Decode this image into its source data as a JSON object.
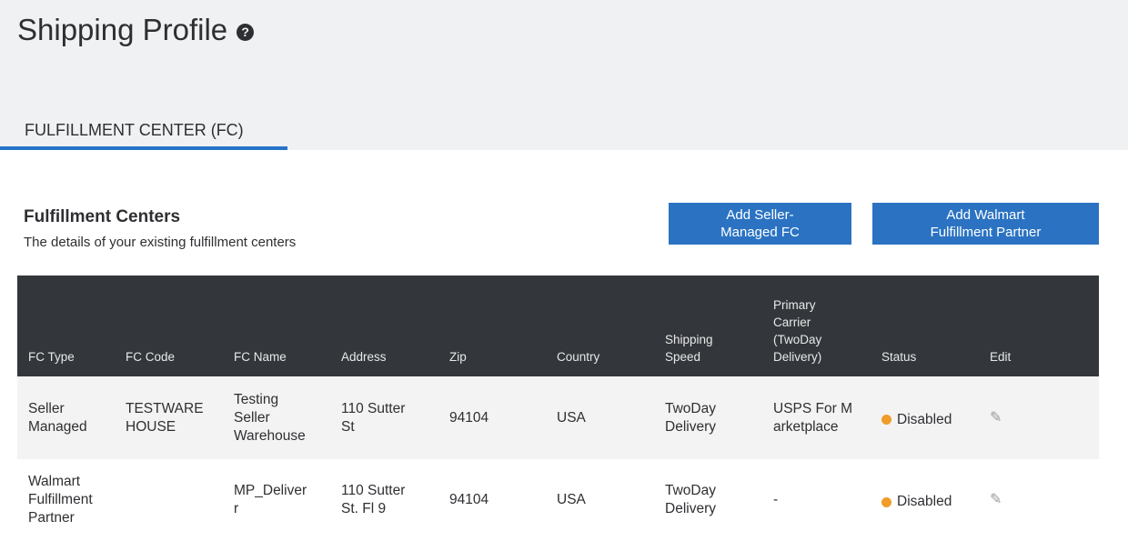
{
  "header": {
    "title": "Shipping Profile",
    "help_icon": "question-circle-icon"
  },
  "tabs": [
    {
      "label": "FULFILLMENT CENTER (FC)",
      "active": true
    }
  ],
  "section": {
    "title": "Fulfillment Centers",
    "subtitle": "The details of your existing fulfillment centers"
  },
  "buttons": {
    "add_seller": {
      "line1": "Add Seller-",
      "line2": "Managed FC"
    },
    "add_walmart": {
      "line1": "Add Walmart",
      "line2": "Fulfillment Partner"
    }
  },
  "table": {
    "columns": [
      "FC Type",
      "FC Code",
      "FC Name",
      "Address",
      "Zip",
      "Country",
      "Shipping Speed",
      "Primary Carrier (TwoDay Delivery)",
      "Status",
      "Edit"
    ],
    "rows": [
      {
        "fc_type": "Seller Managed",
        "fc_code": "TESTWAREHOUSE",
        "fc_name": "Testing Seller Warehouse",
        "address": "110 Sutter St",
        "zip": "94104",
        "country": "USA",
        "shipping_speed": "TwoDay Delivery",
        "primary_carrier": "USPS For Marketplace",
        "status": "Disabled",
        "edit_icon": "pencil-icon"
      },
      {
        "fc_type": "Walmart Fulfillment Partner",
        "fc_code": "",
        "fc_name": "MP_Deliverr",
        "address": "110 Sutter St. Fl 9",
        "zip": "94104",
        "country": "USA",
        "shipping_speed": "TwoDay Delivery",
        "primary_carrier": "-",
        "status": "Disabled",
        "edit_icon": "pencil-icon"
      }
    ]
  },
  "colors": {
    "accent": "#2b73c2",
    "header_bg": "#33373b",
    "status_disabled": "#f09c28",
    "top_band": "#f0f1f2"
  }
}
